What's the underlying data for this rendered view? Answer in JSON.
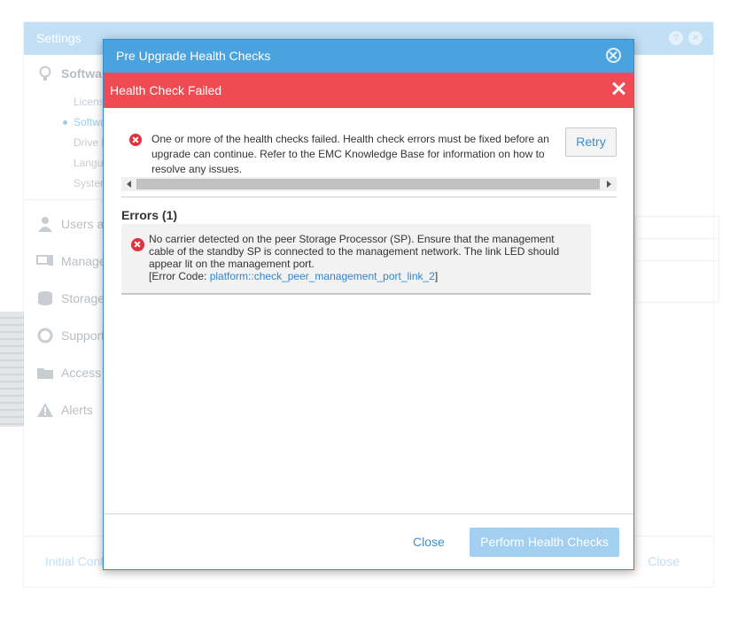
{
  "settings": {
    "title": "Settings",
    "help_icon_glyph": "?",
    "close_icon_glyph": "×",
    "nav": [
      {
        "label": "Softwar",
        "icon": "bulb-icon"
      },
      {
        "label": "Users ar",
        "icon": "user-icon"
      },
      {
        "label": "Manage",
        "icon": "monitor-icon"
      },
      {
        "label": "Storage",
        "icon": "storage-icon"
      },
      {
        "label": "Support",
        "icon": "support-icon"
      },
      {
        "label": "Access",
        "icon": "folder-icon"
      },
      {
        "label": "Alerts",
        "icon": "warning-icon"
      }
    ],
    "software_sub": [
      "Licens",
      "Softwa",
      "Drive F",
      "Langu",
      "Syster"
    ],
    "footer_left": "Initial Conf",
    "footer_right": "Close"
  },
  "dialog": {
    "title": "Pre Upgrade Health Checks",
    "fail_banner": "Health Check Failed",
    "summary": "One or more of the health checks failed. Health check errors must be fixed before an upgrade can continue. Refer to the EMC Knowledge Base for information on how to resolve any issues.",
    "retry_label": "Retry",
    "errors_heading": "Errors (1)",
    "error_message": "No carrier detected on the peer Storage Processor (SP). Ensure that the management cable of the standby SP is connected to the management network. The link LED should appear lit on the management port.",
    "error_code_prefix": "[Error Code: ",
    "error_code": "platform::check_peer_management_port_link_2",
    "error_code_suffix": "]",
    "close_label": "Close",
    "perform_label": "Perform Health Checks"
  },
  "colors": {
    "header_blue": "#4aa3df",
    "fail_red": "#f04a52",
    "error_icon_red": "#e0323e",
    "link_blue": "#3a8ed3"
  }
}
